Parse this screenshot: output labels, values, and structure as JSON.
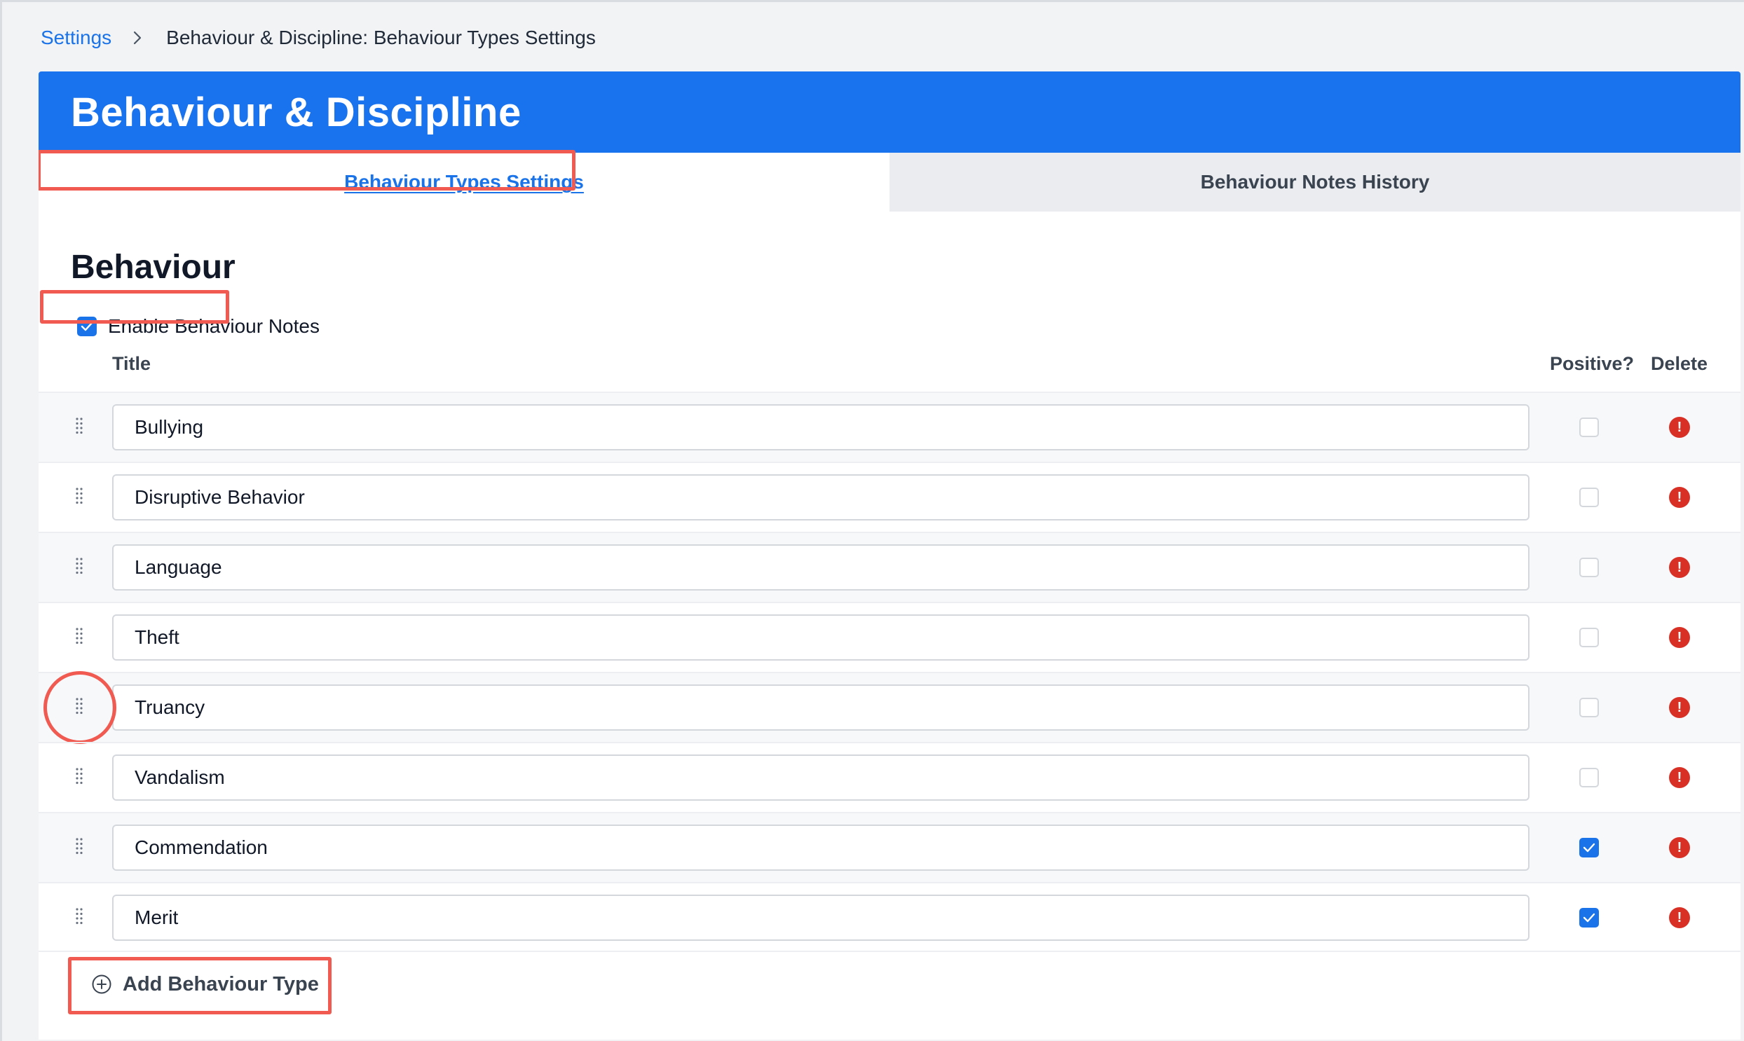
{
  "breadcrumb": {
    "root": "Settings",
    "current": "Behaviour & Discipline: Behaviour Types Settings"
  },
  "header": {
    "title": "Behaviour & Discipline"
  },
  "tabs": [
    {
      "label": "Behaviour Types Settings",
      "active": true
    },
    {
      "label": "Behaviour Notes History",
      "active": false
    }
  ],
  "section": {
    "title": "Behaviour",
    "enable_label": "Enable Behaviour Notes",
    "enable_checked": true
  },
  "columns": {
    "title": "Title",
    "positive": "Positive?",
    "delete": "Delete"
  },
  "behaviour_types": [
    {
      "title": "Bullying",
      "positive": false
    },
    {
      "title": "Disruptive Behavior",
      "positive": false
    },
    {
      "title": "Language",
      "positive": false
    },
    {
      "title": "Theft",
      "positive": false
    },
    {
      "title": "Truancy",
      "positive": false
    },
    {
      "title": "Vandalism",
      "positive": false
    },
    {
      "title": "Commendation",
      "positive": true
    },
    {
      "title": "Merit",
      "positive": true
    }
  ],
  "add_button": {
    "label": "Add Behaviour Type"
  },
  "colors": {
    "accent": "#1a73e8",
    "header": "#1a73ee",
    "delete": "#d93025",
    "annotation": "#f05a50"
  },
  "icons": {
    "breadcrumb_separator": "chevron-right-icon",
    "drag": "drag-handle-icon",
    "delete": "exclamation-circle-icon",
    "add": "plus-circle-icon",
    "check": "checkmark-icon"
  }
}
